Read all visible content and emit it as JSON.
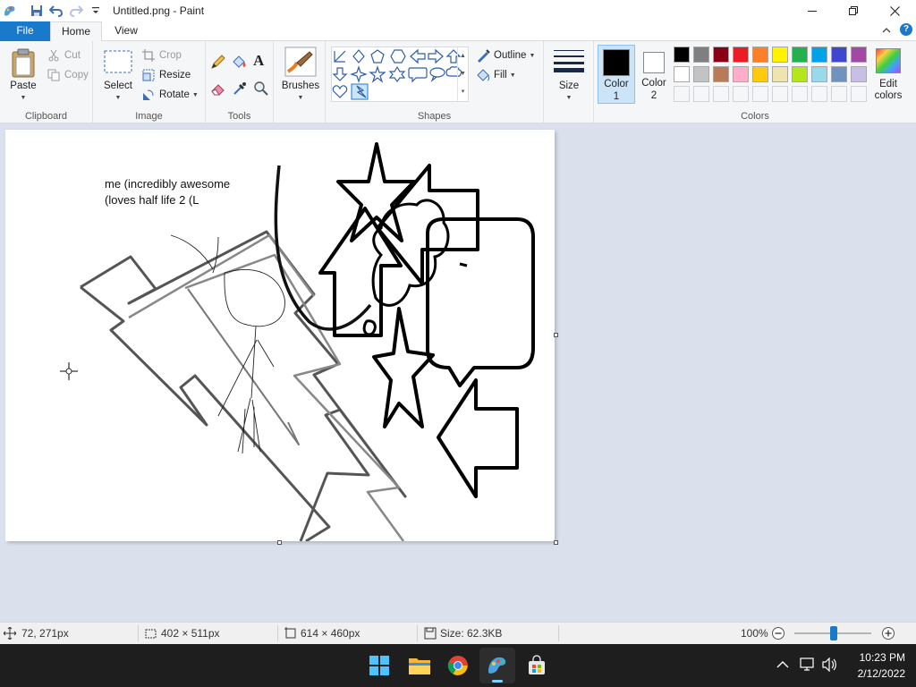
{
  "window": {
    "title": "Untitled.png - Paint"
  },
  "tabs": {
    "file": "File",
    "home": "Home",
    "view": "View"
  },
  "ribbon": {
    "clipboard": {
      "paste": "Paste",
      "cut": "Cut",
      "copy": "Copy",
      "label": "Clipboard"
    },
    "image": {
      "select": "Select",
      "crop": "Crop",
      "resize": "Resize",
      "rotate": "Rotate",
      "label": "Image"
    },
    "tools": {
      "label": "Tools"
    },
    "brushes": {
      "label": "Brushes"
    },
    "shapes": {
      "outline": "Outline",
      "fill": "Fill",
      "label": "Shapes"
    },
    "size": {
      "label": "Size"
    },
    "colors": {
      "color1": "Color",
      "color1_num": "1",
      "color2": "Color",
      "color2_num": "2",
      "edit_line1": "Edit",
      "edit_line2": "colors",
      "label": "Colors",
      "color1_value": "#000000",
      "color2_value": "#ffffff",
      "palette_row1": [
        "#000000",
        "#7f7f7f",
        "#880015",
        "#ed1c24",
        "#ff7f27",
        "#fff200",
        "#22b14c",
        "#00a2e8",
        "#3f48cc",
        "#a349a4"
      ],
      "palette_row2": [
        "#ffffff",
        "#c3c3c3",
        "#b97a57",
        "#ffaec9",
        "#ffc90e",
        "#efe4b0",
        "#b5e61d",
        "#99d9ea",
        "#7092be",
        "#c8bfe7"
      ]
    }
  },
  "canvas": {
    "text_line1": "me (incredibly awesome",
    "text_line2": "(loves half life 2 (L"
  },
  "status": {
    "cursor": "72, 271px",
    "selection": "402 × 511px",
    "image_size": "614 × 460px",
    "file_size": "Size: 62.3KB",
    "zoom": "100%",
    "zoom_level": 1.0
  },
  "taskbar": {
    "time": "10:23 PM",
    "date": "2/12/2022"
  }
}
